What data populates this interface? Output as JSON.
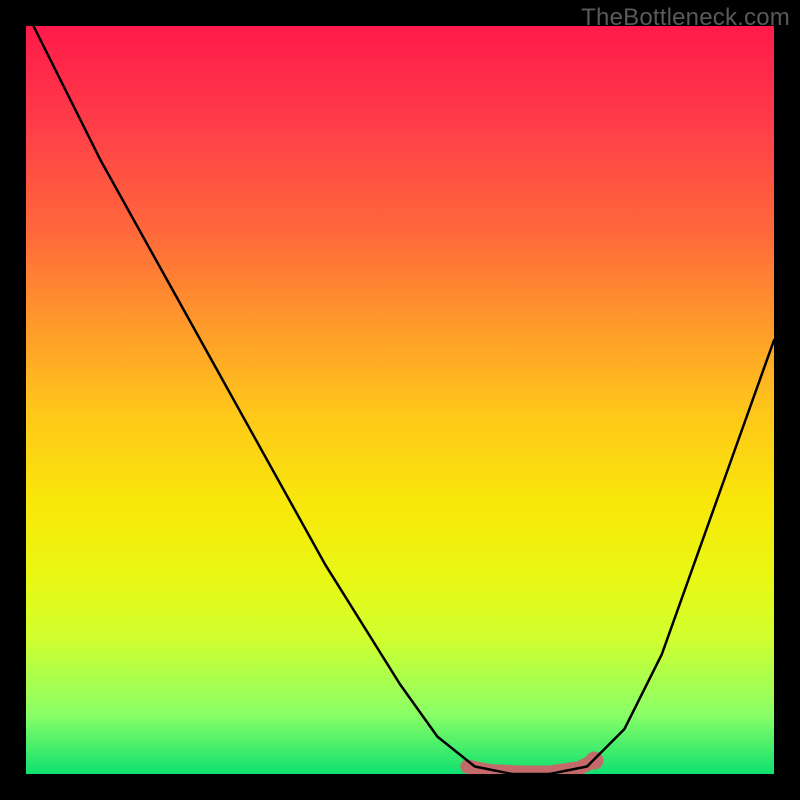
{
  "watermark": "TheBottleneck.com",
  "chart_data": {
    "type": "line",
    "title": "",
    "xlabel": "",
    "ylabel": "",
    "xlim": [
      0,
      100
    ],
    "ylim": [
      0,
      100
    ],
    "grid": false,
    "series": [
      {
        "name": "bottleneck-curve",
        "color": "#000000",
        "points": [
          {
            "x": 1,
            "y": 100
          },
          {
            "x": 10,
            "y": 82
          },
          {
            "x": 20,
            "y": 64
          },
          {
            "x": 30,
            "y": 46
          },
          {
            "x": 40,
            "y": 28
          },
          {
            "x": 50,
            "y": 12
          },
          {
            "x": 55,
            "y": 5
          },
          {
            "x": 60,
            "y": 1
          },
          {
            "x": 65,
            "y": 0
          },
          {
            "x": 70,
            "y": 0
          },
          {
            "x": 75,
            "y": 1
          },
          {
            "x": 80,
            "y": 6
          },
          {
            "x": 85,
            "y": 16
          },
          {
            "x": 90,
            "y": 30
          },
          {
            "x": 95,
            "y": 44
          },
          {
            "x": 100,
            "y": 58
          }
        ]
      },
      {
        "name": "optimal-range-marker",
        "color": "#c56a6a",
        "points": [
          {
            "x": 59,
            "y": 1
          },
          {
            "x": 62,
            "y": 0.4
          },
          {
            "x": 66,
            "y": 0.2
          },
          {
            "x": 70,
            "y": 0.2
          },
          {
            "x": 74,
            "y": 0.8
          },
          {
            "x": 76,
            "y": 1.8
          }
        ]
      }
    ],
    "gradient_stops": [
      {
        "pct": 0,
        "color": "#ff1a4a"
      },
      {
        "pct": 50,
        "color": "#ffc81a"
      },
      {
        "pct": 80,
        "color": "#d0ff30"
      },
      {
        "pct": 100,
        "color": "#10e070"
      }
    ]
  }
}
